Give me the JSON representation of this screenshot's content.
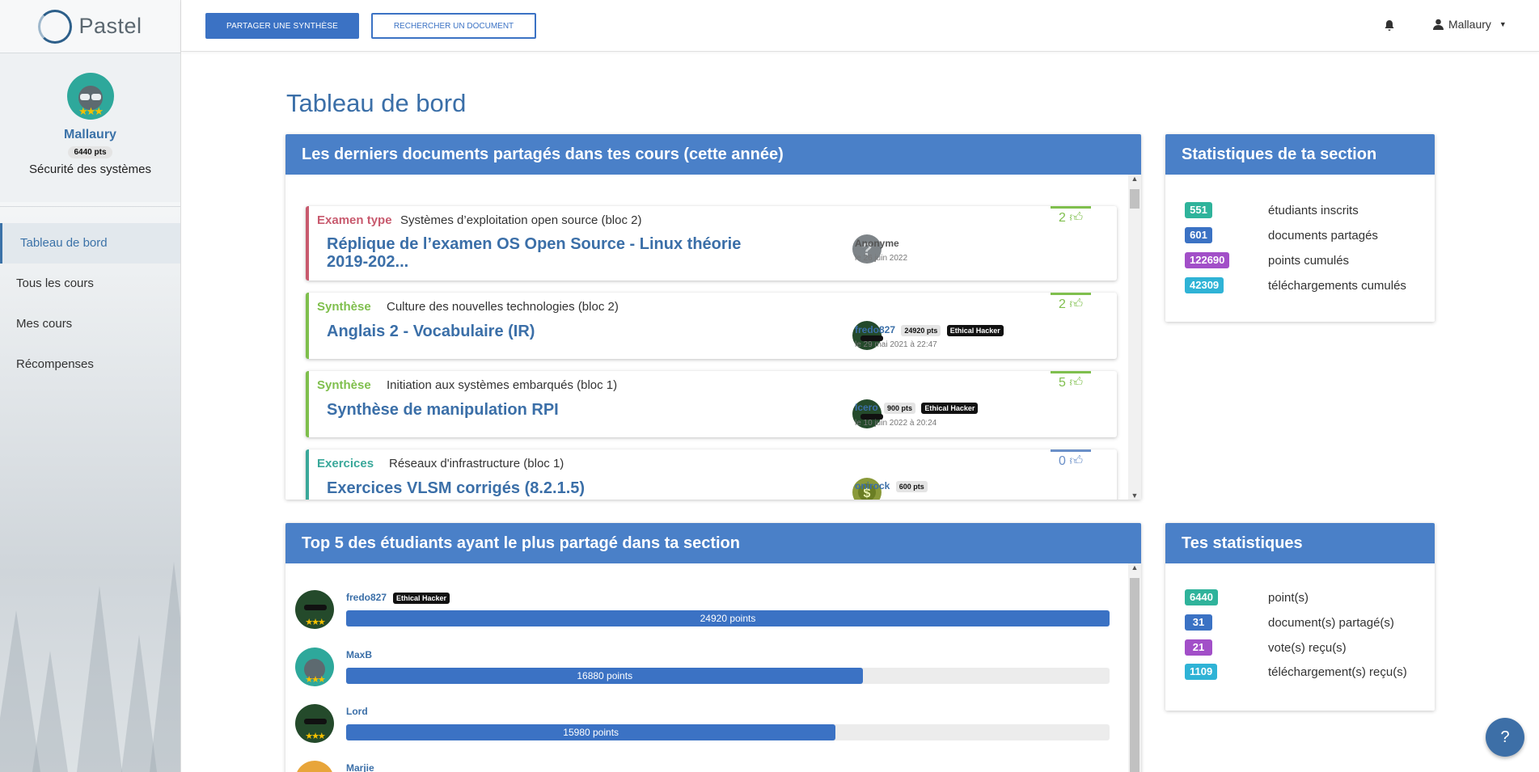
{
  "app": {
    "name": "Pastel"
  },
  "topbar": {
    "share_label": "Partager une synthèse",
    "search_label": "Rechercher un document",
    "user": "Mallaury"
  },
  "profile": {
    "name": "Mallaury",
    "points": "6440 pts",
    "section": "Sécurité des systèmes"
  },
  "nav": [
    {
      "label": "Tableau de bord",
      "active": true
    },
    {
      "label": "Tous les cours"
    },
    {
      "label": "Mes cours"
    },
    {
      "label": "Récompenses"
    }
  ],
  "page": {
    "title": "Tableau de bord"
  },
  "recent_docs": {
    "heading": "Les derniers documents partagés dans tes cours (cette année)",
    "items": [
      {
        "type": "Examen type",
        "type_color": "#c85a6e",
        "course": "Systèmes d’exploitation open source (bloc 2)",
        "title": "Réplique de l’examen OS Open Source - Linux théorie 2019-202...",
        "author": "Anonyme",
        "date": "le 26 juin 2022",
        "votes": "2",
        "vote_color": "#7fbf4d"
      },
      {
        "type": "Synthèse",
        "type_color": "#7fbf4d",
        "course": "Culture des nouvelles technologies (bloc 2)",
        "title": "Anglais 2 - Vocabulaire (IR)",
        "author": "fredo827",
        "points": "24920 pts",
        "rank": "Ethical Hacker",
        "date": "le 29 mai 2021 à 22:47",
        "votes": "2",
        "vote_color": "#7fbf4d"
      },
      {
        "type": "Synthèse",
        "type_color": "#7fbf4d",
        "course": "Initiation aux systèmes embarqués (bloc 1)",
        "title": "Synthèse de manipulation RPI",
        "author": "Icero",
        "points": "900 pts",
        "rank": "Ethical Hacker",
        "date": "le 10 juin 2022 à 20:24",
        "votes": "5",
        "vote_color": "#7fbf4d"
      },
      {
        "type": "Exercices",
        "type_color": "#3aa89a",
        "course": "Réseaux d'infrastructure (bloc 1)",
        "title": "Exercices VLSM corrigés (8.2.1.5)",
        "author": "onirock",
        "points": "600 pts",
        "votes": "0",
        "vote_color": "#6a8fc8"
      }
    ]
  },
  "section_stats": {
    "heading": "Statistiques de ta section",
    "rows": [
      {
        "value": "551",
        "label": "étudiants inscrits",
        "color": "#2fb39b"
      },
      {
        "value": "601",
        "label": "documents partagés",
        "color": "#3b72c4"
      },
      {
        "value": "122690",
        "label": "points cumulés",
        "color": "#a24fc8"
      },
      {
        "value": "42309",
        "label": "téléchargements cumulés",
        "color": "#2fb3d6"
      }
    ]
  },
  "top5": {
    "heading": "Top 5 des étudiants ayant le plus partagé dans ta section",
    "max": 24920,
    "items": [
      {
        "name": "fredo827",
        "rank": "Ethical Hacker",
        "points": 24920,
        "points_label": "24920 points"
      },
      {
        "name": "MaxB",
        "points": 16880,
        "points_label": "16880 points"
      },
      {
        "name": "Lord",
        "points": 15980,
        "points_label": "15980 points"
      },
      {
        "name": "Marjie"
      }
    ]
  },
  "my_stats": {
    "heading": "Tes statistiques",
    "rows": [
      {
        "value": "6440",
        "label": "point(s)",
        "color": "#2fb39b"
      },
      {
        "value": "31",
        "label": "document(s) partagé(s)",
        "color": "#3b72c4"
      },
      {
        "value": "21",
        "label": "vote(s) reçu(s)",
        "color": "#a24fc8"
      },
      {
        "value": "1109",
        "label": "téléchargement(s) reçu(s)",
        "color": "#2fb3d6"
      }
    ]
  },
  "help": {
    "label": "?"
  }
}
